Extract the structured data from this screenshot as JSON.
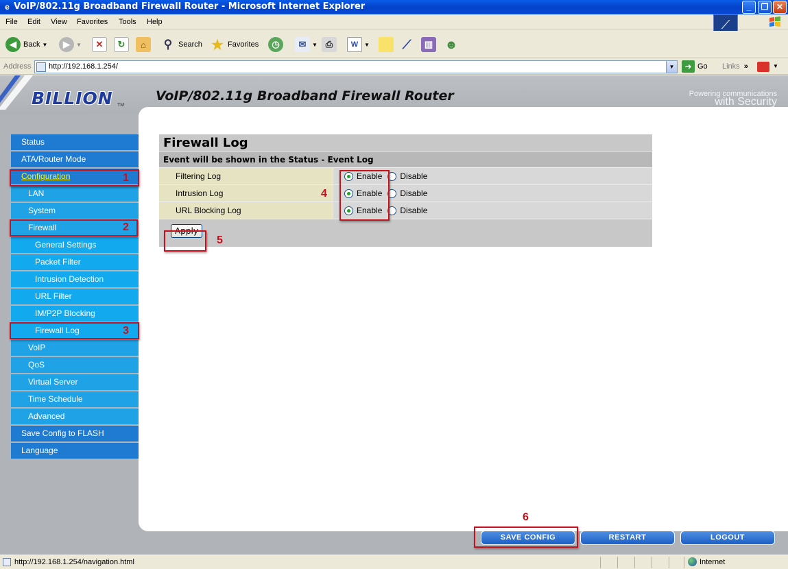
{
  "window": {
    "title": "VoIP/802.11g Broadband Firewall Router - Microsoft Internet Explorer",
    "minimize": "_",
    "maximize": "❐",
    "close": "✕"
  },
  "menu": [
    "File",
    "Edit",
    "View",
    "Favorites",
    "Tools",
    "Help"
  ],
  "toolbar": {
    "back": "Back",
    "search": "Search",
    "favorites": "Favorites"
  },
  "address": {
    "label": "Address",
    "url": "http://192.168.1.254/",
    "go": "Go",
    "links": "Links"
  },
  "header": {
    "logo": "BILLION",
    "tm": "TM",
    "product_title": "VoIP/802.11g Broadband Firewall Router",
    "tagline_1": "Powering communications",
    "tagline_2": "with Security"
  },
  "sidebar": {
    "items": [
      {
        "label": "Status"
      },
      {
        "label": "ATA/Router Mode"
      },
      {
        "label": "Configuration"
      },
      {
        "label": "LAN"
      },
      {
        "label": "System"
      },
      {
        "label": "Firewall"
      },
      {
        "label": "General Settings"
      },
      {
        "label": "Packet Filter"
      },
      {
        "label": "Intrusion Detection"
      },
      {
        "label": "URL Filter"
      },
      {
        "label": "IM/P2P Blocking"
      },
      {
        "label": "Firewall Log"
      },
      {
        "label": "VoIP"
      },
      {
        "label": "QoS"
      },
      {
        "label": "Virtual Server"
      },
      {
        "label": "Time Schedule"
      },
      {
        "label": "Advanced"
      },
      {
        "label": "Save Config to FLASH"
      },
      {
        "label": "Language"
      }
    ]
  },
  "firewall_log": {
    "title": "Firewall Log",
    "subtitle": "Event will be shown in the Status - Event Log",
    "rows": [
      {
        "label": "Filtering Log",
        "enable": "Enable",
        "disable": "Disable"
      },
      {
        "label": "Intrusion Log",
        "enable": "Enable",
        "disable": "Disable"
      },
      {
        "label": "URL Blocking Log",
        "enable": "Enable",
        "disable": "Disable"
      }
    ],
    "apply": "Apply"
  },
  "bottom_buttons": {
    "save": "SAVE CONFIG",
    "restart": "RESTART",
    "logout": "LOGOUT"
  },
  "annotations": [
    "1",
    "2",
    "3",
    "4",
    "5",
    "6"
  ],
  "statusbar": {
    "text": "http://192.168.1.254/navigation.html",
    "zone": "Internet"
  },
  "colors": {
    "nav_level1": "#1f7ad2",
    "nav_level2": "#1fa3e6",
    "annotation_red": "#c8101a",
    "logo_blue": "#1f3c9c"
  }
}
